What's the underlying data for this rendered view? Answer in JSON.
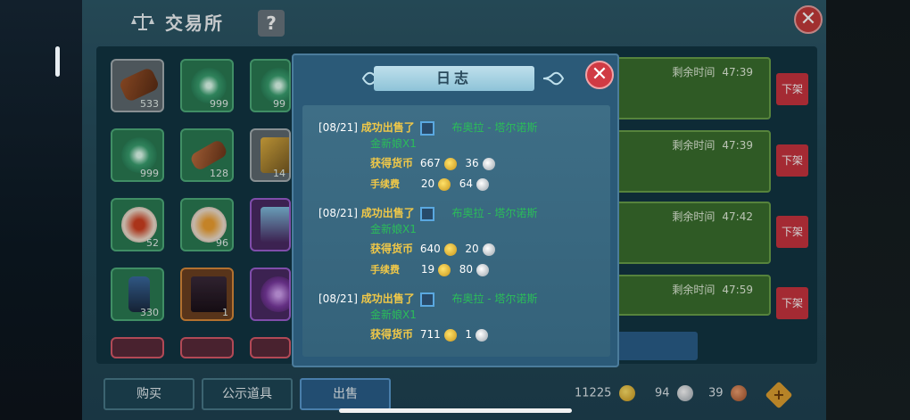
{
  "panel": {
    "title": "交易所",
    "help_label": "?",
    "close_label": "✕"
  },
  "inventory": [
    {
      "count": "533"
    },
    {
      "count": "999"
    },
    {
      "count": "99"
    },
    {
      "count": "999"
    },
    {
      "count": "128"
    },
    {
      "count": "14"
    },
    {
      "count": "52"
    },
    {
      "count": "96"
    },
    {
      "count": ""
    },
    {
      "count": "330"
    },
    {
      "count": "1"
    },
    {
      "count": ""
    }
  ],
  "listings": [
    {
      "remain_label": "剩余时间",
      "remain_time": "47:39",
      "off_label": "下架"
    },
    {
      "remain_label": "剩余时间",
      "remain_time": "47:39",
      "off_label": "下架"
    },
    {
      "remain_label": "剩余时间",
      "remain_time": "47:42",
      "off_label": "下架"
    },
    {
      "remain_label": "剩余时间",
      "remain_time": "47:59",
      "off_label": "下架"
    }
  ],
  "tabs": [
    {
      "label": "购买"
    },
    {
      "label": "公示道具"
    },
    {
      "label": "出售"
    }
  ],
  "currency": {
    "gold": "11225",
    "silver": "94",
    "copper": "39",
    "plus_label": "+"
  },
  "modal": {
    "title": "日志",
    "close_label": "✕",
    "entries": [
      {
        "date": "[08/21]",
        "sold_label": "成功出售了",
        "item_line1": "布奥拉 - 塔尔诺斯",
        "item_line2": "金新娘X1",
        "gain_label": "获得货币",
        "gain_gold": "667",
        "gain_silver": "36",
        "fee_label": "手续费",
        "fee_gold": "20",
        "fee_silver": "64"
      },
      {
        "date": "[08/21]",
        "sold_label": "成功出售了",
        "item_line1": "布奥拉 - 塔尔诺斯",
        "item_line2": "金新娘X1",
        "gain_label": "获得货币",
        "gain_gold": "640",
        "gain_silver": "20",
        "fee_label": "手续费",
        "fee_gold": "19",
        "fee_silver": "80"
      },
      {
        "date": "[08/21]",
        "sold_label": "成功出售了",
        "item_line1": "布奥拉 - 塔尔诺斯",
        "item_line2": "金新娘X1",
        "gain_label": "获得货币",
        "gain_gold": "711",
        "gain_silver": "1"
      }
    ]
  }
}
